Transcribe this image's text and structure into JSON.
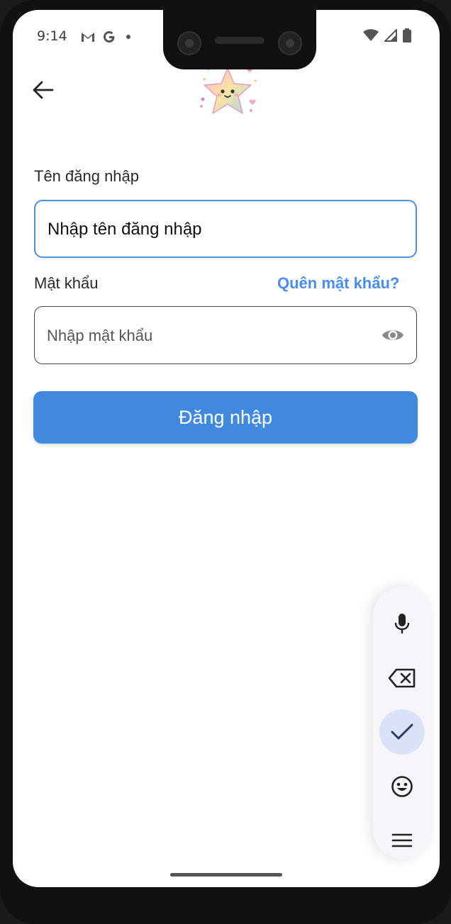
{
  "status_bar": {
    "time": "9:14",
    "left_icons": [
      "gmail-icon",
      "google-icon",
      "dot-icon"
    ],
    "right_icons": [
      "wifi-icon",
      "signal-icon",
      "battery-icon"
    ]
  },
  "header": {
    "back_icon": "arrow-left-icon",
    "logo": "star-mascot-logo"
  },
  "form": {
    "username_label": "Tên đăng nhập",
    "username_value": "Nhập tên đăng nhập",
    "password_label": "Mật khẩu",
    "forgot_link": "Quên mật khẩu?",
    "password_placeholder": "Nhập mật khẩu",
    "eye_icon": "eye-icon",
    "submit_label": "Đăng nhập"
  },
  "keyboard_toolbar": {
    "items": [
      "microphone-icon",
      "backspace-icon",
      "check-icon",
      "emoji-icon",
      "menu-icon"
    ],
    "active": "check-icon"
  },
  "colors": {
    "accent": "#4189df",
    "link": "#4a8cf7",
    "focus_border": "#4a90e2"
  }
}
